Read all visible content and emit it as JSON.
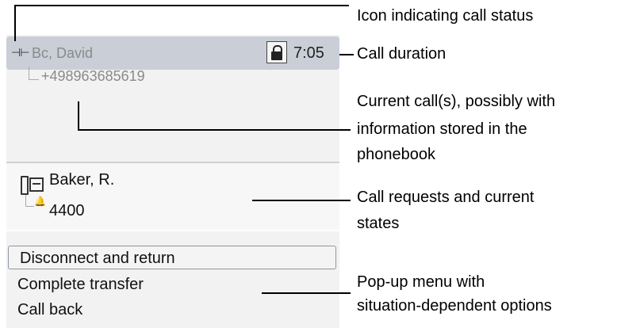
{
  "screen": {
    "caller_name": "Bc, David",
    "call_duration": "7:05",
    "phone_number": "+498963685619",
    "status_icon": "connected-icon",
    "lock_icon": "lock-icon",
    "request": {
      "name": "Baker, R.",
      "number": "4400",
      "icon": "phonebook-icon",
      "state_icon": "bell-icon"
    },
    "menu": [
      {
        "label": "Disconnect and return",
        "selected": true
      },
      {
        "label": "Complete transfer",
        "selected": false
      },
      {
        "label": "Call back",
        "selected": false
      }
    ]
  },
  "annotations": {
    "status_icon": "Icon indicating call status",
    "duration": "Call duration",
    "current_calls_line1": "Current call(s), possibly with",
    "current_calls_line2": "information stored in the",
    "current_calls_line3": "phonebook",
    "requests_line1": "Call requests and current",
    "requests_line2": "states",
    "menu_line1": "Pop-up menu with",
    "menu_line2": "situation-dependent options"
  }
}
